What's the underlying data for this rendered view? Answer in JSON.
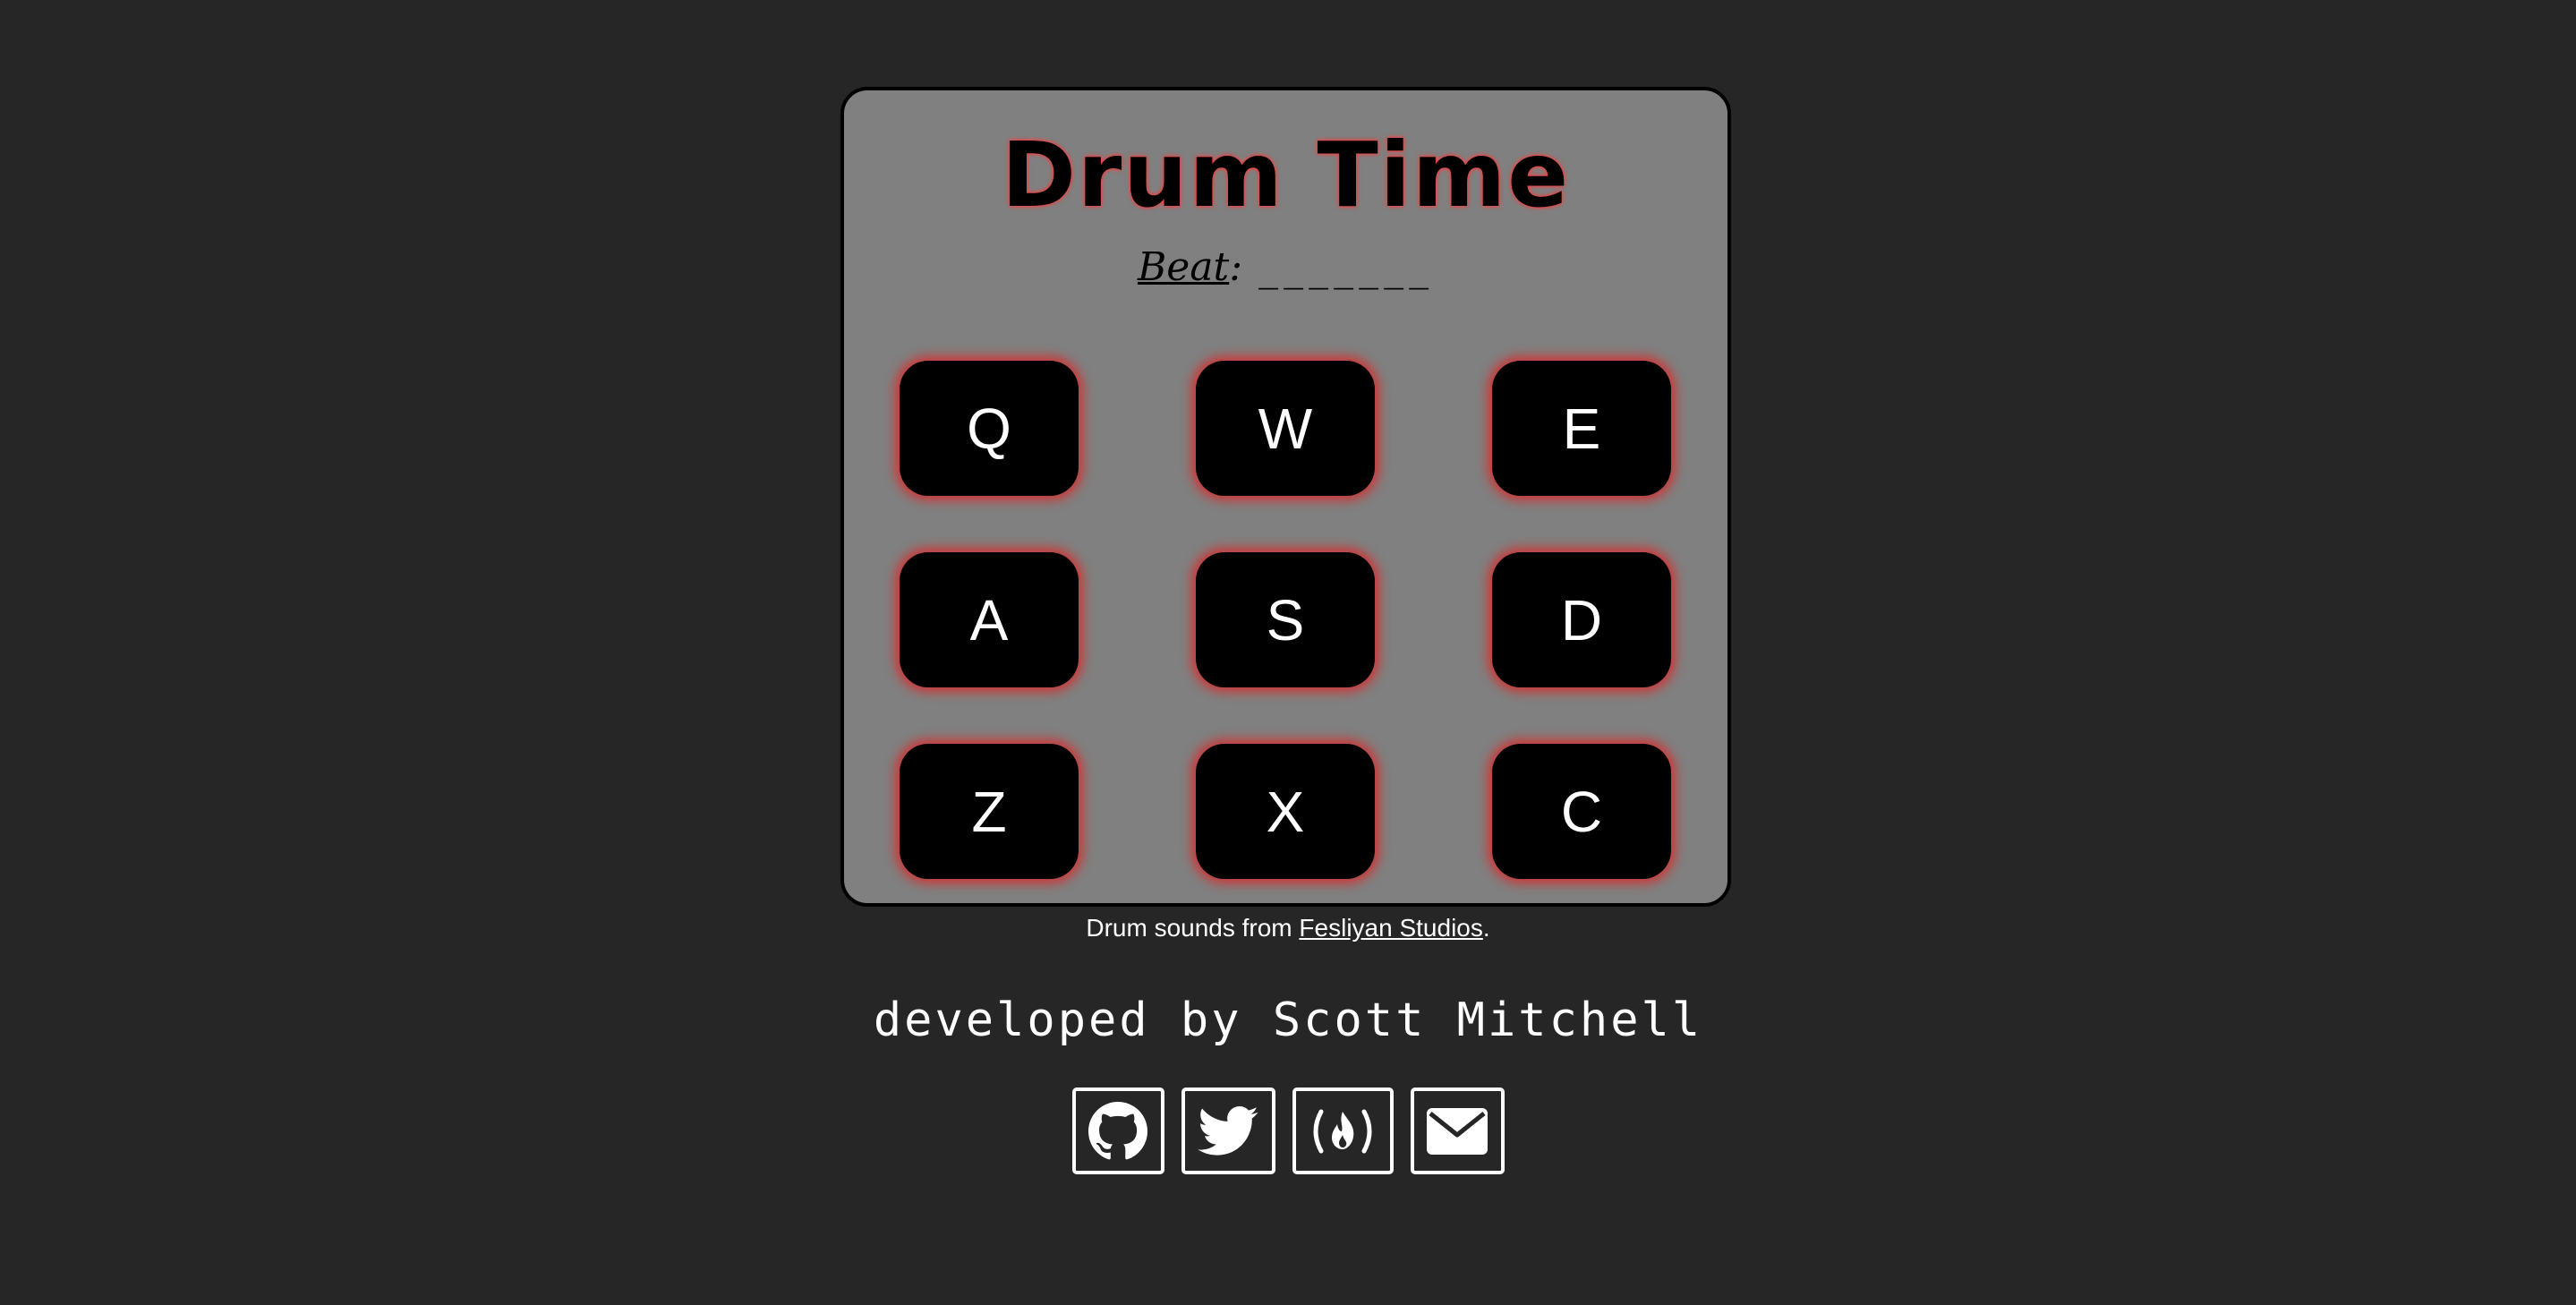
{
  "title": "Drum Time",
  "beat": {
    "label": "Beat",
    "separator": ":",
    "value": "_______"
  },
  "pads": [
    {
      "key": "Q"
    },
    {
      "key": "W"
    },
    {
      "key": "E"
    },
    {
      "key": "A"
    },
    {
      "key": "S"
    },
    {
      "key": "D"
    },
    {
      "key": "Z"
    },
    {
      "key": "X"
    },
    {
      "key": "C"
    }
  ],
  "credit": {
    "prefix": "Drum sounds from ",
    "link_text": "Fesliyan Studios",
    "suffix": "."
  },
  "developer": "developed by Scott Mitchell",
  "social": [
    {
      "icon": "github-icon"
    },
    {
      "icon": "twitter-icon"
    },
    {
      "icon": "freecodecamp-icon"
    },
    {
      "icon": "envelope-icon"
    }
  ],
  "colors": {
    "background": "#262626",
    "panel": "#808080",
    "pad": "#000000",
    "glow": "#dc2828",
    "text": "#ffffff"
  }
}
